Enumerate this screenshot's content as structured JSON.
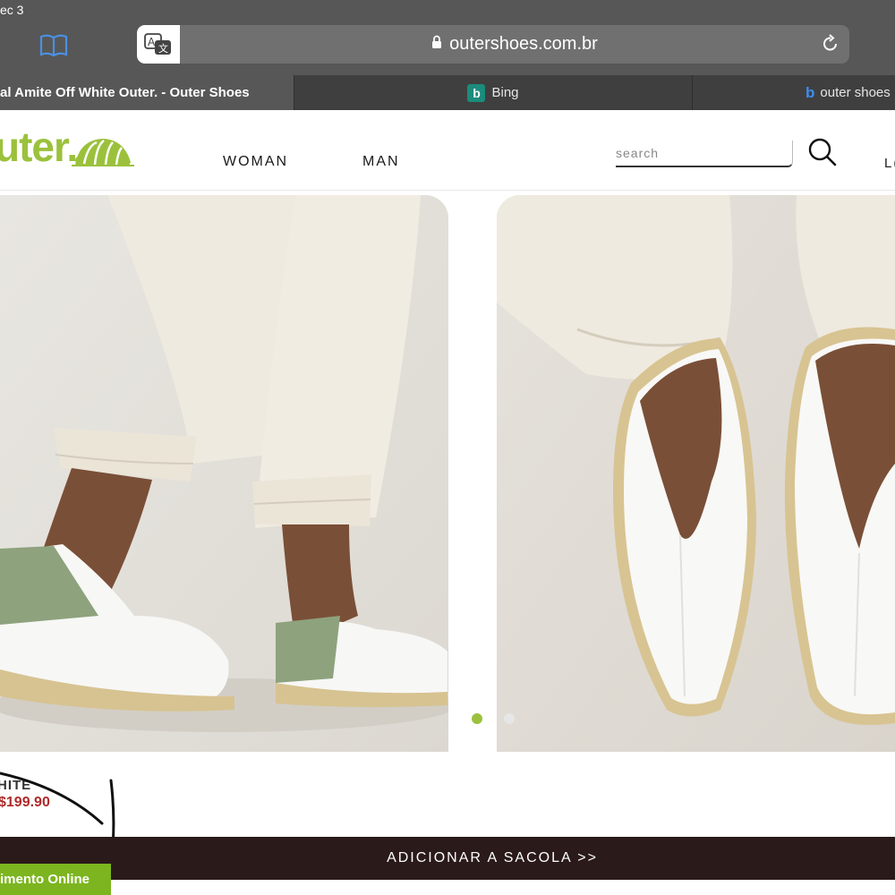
{
  "status_bar": {
    "date": "ec 3"
  },
  "browser": {
    "url": "outershoes.com.br",
    "tabs": [
      {
        "label": "al Amite Off White Outer. - Outer Shoes",
        "active": true
      },
      {
        "label": "Bing",
        "active": false
      },
      {
        "label": "outer shoes",
        "active": false
      }
    ]
  },
  "site": {
    "logo_text": "uter.",
    "nav": [
      {
        "label": "WOMAN"
      },
      {
        "label": "MAN"
      }
    ],
    "search_placeholder": "search",
    "login_label": "L("
  },
  "product": {
    "name": "HITE",
    "price": "$199.90",
    "add_to_bag_label": "ADICIONAR A SACOLA >>",
    "online_badge": "imento Online"
  },
  "carousel": {
    "active_dot_color": "#9bc13c",
    "inactive_dot_color": "#e6e6e6"
  },
  "colors": {
    "brand_green": "#9bc13c",
    "button_dark": "#2b1a1a",
    "price_red": "#b02a2a"
  }
}
